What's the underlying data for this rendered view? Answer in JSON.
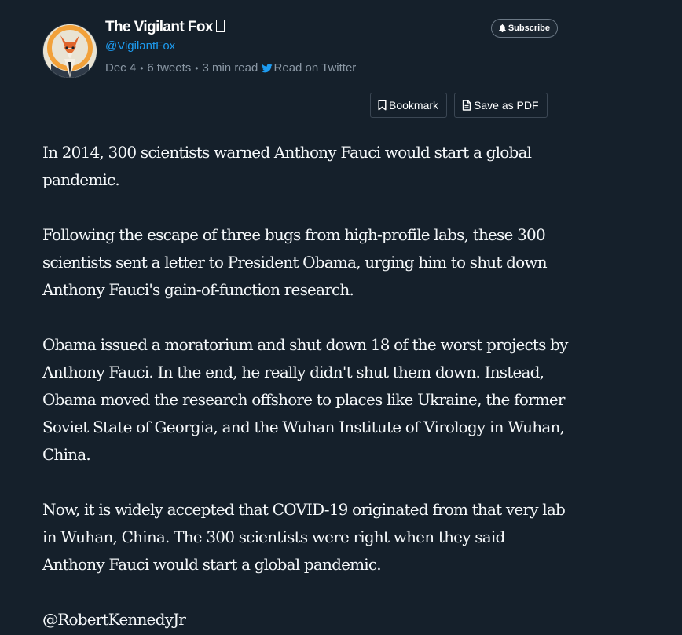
{
  "author": {
    "name": "The Vigilant Fox",
    "handle": "@VigilantFox"
  },
  "meta": {
    "date": "Dec 4",
    "tweets": "6 tweets",
    "read_time": "3 min read",
    "twitter_link": "Read on Twitter"
  },
  "buttons": {
    "subscribe": "Subscribe",
    "bookmark": "Bookmark",
    "save_pdf": "Save as PDF"
  },
  "article": {
    "paragraphs": [
      "In 2014, 300 scientists warned Anthony Fauci would start a global pandemic.",
      "Following the escape of three bugs from high-profile labs, these 300 scientists sent a letter to President Obama, urging him to shut down Anthony Fauci's gain-of-function research.",
      "Obama issued a moratorium and shut down 18 of the worst projects by Anthony Fauci. In the end, he really didn't shut them down. Instead, Obama moved the research offshore to places like Ukraine, the former Soviet State of Georgia, and the Wuhan Institute of Virology in Wuhan, China.",
      "Now, it is widely accepted that COVID-19 originated from that very lab in Wuhan, China. The 300 scientists were right when they said Anthony Fauci would start a global pandemic.",
      "@RobertKennedyJr"
    ]
  },
  "colors": {
    "background": "#15202b",
    "text": "#f5f8fa",
    "link": "#1d9bf0",
    "muted": "#8b98a5"
  }
}
